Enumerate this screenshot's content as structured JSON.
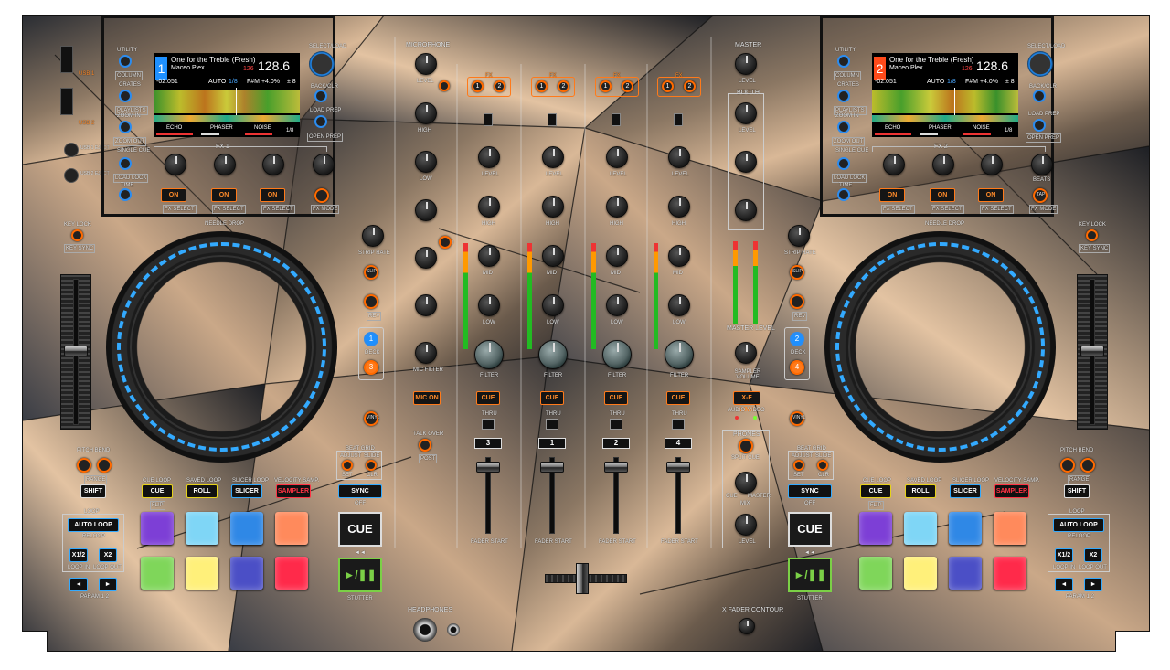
{
  "app": {
    "title": "DJ Controller Skin"
  },
  "colors": {
    "accent_orange": "#ff7a1a",
    "accent_blue": "#33aaff",
    "cue_yellow": "#e6d21a",
    "sampler_red": "#ff3344",
    "body_dark": "#2a2a2a"
  },
  "ports": {
    "usb1": "USB 1",
    "usb2": "USB 2",
    "usb1_eject": "USB 1 EJECT",
    "usb2_eject": "USB 2 EJECT"
  },
  "left": {
    "screen": {
      "deck_num": "1",
      "title": "One for the Treble (Fresh)",
      "artist": "Maceo Plex",
      "bpm": "128.6",
      "bpm_small": "126",
      "time": "-02:051",
      "auto": "AUTO",
      "loop": "1/8",
      "key": "F#M +4.0%",
      "range": "± 8",
      "fx": [
        "ECHO",
        "PHASER",
        "NOISE"
      ],
      "beats": "1/8"
    },
    "side_left": [
      "UTILITY",
      "VIEW",
      "COLUMN",
      "CRATES",
      "PLAYLISTS",
      "ZOOM IN",
      "ZOOM OUT",
      "SINGLE CUE",
      "LOAD LOCK",
      "TIME"
    ],
    "side_right": [
      "SELECT/LOAD",
      "BACK/CLR",
      "LOAD PREP",
      "OPEN PREP"
    ],
    "fx_title": "FX 1",
    "fx_knob_labels": [
      "MIN",
      "MAX"
    ],
    "fx_on": "ON",
    "fx_select": "FX SELECT",
    "beats": "BEATS",
    "tap": "TAP",
    "fx_mode": "FX MODE",
    "key_lock": "KEY LOCK",
    "key_sync": "KEY SYNC",
    "needle_drop": "NEEDLE DROP",
    "strip_rate": "STRIP RATE",
    "slip": "SLIP",
    "censor": "CENSOR",
    "rev": "REV",
    "deck": "DECK",
    "deck_a": "1",
    "deck_b": "3",
    "vinyl": "VINYL",
    "pitch_bend": "PITCH BEND",
    "range": "RANGE",
    "shift": "SHIFT",
    "beat_grid": "BEAT GRID",
    "adjust": "ADJUST",
    "slide": "SLIDE",
    "set": "SET",
    "clr": "CLR",
    "sync": "SYNC",
    "off": "OFF",
    "modes": {
      "cue_loop": "CUE LOOP",
      "saved_loop": "SAVED LOOP",
      "slicer_loop": "SLICER LOOP",
      "velocity": "VELOCITY SAMP.",
      "cue": "CUE",
      "roll": "ROLL",
      "slicer": "SLICER",
      "sampler": "SAMPLER",
      "flip": "FLIP"
    },
    "loop": {
      "title": "LOOP",
      "auto": "AUTO LOOP",
      "reloop": "RELOOP",
      "half": "X1/2",
      "double": "X2",
      "in": "LOOP IN",
      "out": "LOOP OUT",
      "param": "PARAM 1 2"
    },
    "transport": {
      "cue": "CUE",
      "play": "►/❚❚",
      "stutter": "STUTTER"
    }
  },
  "right": {
    "screen": {
      "deck_num": "2",
      "title": "One for the Treble (Fresh)",
      "artist": "Maceo Plex",
      "bpm": "128.6",
      "bpm_small": "126",
      "time": "-02:051",
      "auto": "AUTO",
      "loop": "1/8",
      "key": "F#M +4.0%",
      "range": "± 8",
      "fx": [
        "ECHO",
        "PHASER",
        "NOISE"
      ],
      "beats": "1/8"
    },
    "side_left": [
      "UTILITY",
      "VIEW",
      "COLUMN",
      "CRATES",
      "PLAYLISTS",
      "ZOOM IN",
      "ZOOM OUT",
      "SINGLE CUE",
      "LOAD LOCK",
      "TIME"
    ],
    "side_right": [
      "SELECT/LOAD",
      "BACK/CLR",
      "LOAD PREP",
      "OPEN PREP"
    ],
    "fx_title": "FX 2",
    "fx_on": "ON",
    "fx_select": "FX SELECT",
    "beats": "BEATS",
    "tap": "TAP",
    "fx_mode": "FX MODE",
    "key_lock": "KEY LOCK",
    "key_sync": "KEY SYNC",
    "needle_drop": "NEEDLE DROP",
    "strip_rate": "STRIP RATE",
    "slip": "SLIP",
    "censor": "CENSOR",
    "rev": "REV",
    "deck": "DECK",
    "deck_a": "2",
    "deck_b": "4",
    "vinyl": "VINYL",
    "pitch_bend": "PITCH BEND",
    "range": "RANGE",
    "shift": "SHIFT",
    "beat_grid": "BEAT GRID",
    "adjust": "ADJUST",
    "slide": "SLIDE",
    "set": "SET",
    "clr": "CLR",
    "sync": "SYNC",
    "off": "OFF",
    "modes": {
      "cue_loop": "CUE LOOP",
      "saved_loop": "SAVED LOOP",
      "slicer_loop": "SLICER LOOP",
      "velocity": "VELOCITY SAMP.",
      "cue": "CUE",
      "roll": "ROLL",
      "slicer": "SLICER",
      "sampler": "SAMPLER",
      "flip": "FLIP"
    },
    "loop": {
      "title": "LOOP",
      "auto": "AUTO LOOP",
      "reloop": "RELOOP",
      "half": "X1/2",
      "double": "X2",
      "in": "LOOP IN",
      "out": "LOOP OUT",
      "param": "PARAM 1 2"
    },
    "transport": {
      "cue": "CUE",
      "play": "►/❚❚",
      "stutter": "STUTTER"
    }
  },
  "mixer": {
    "microphone": "MICROPHONE",
    "mic_level": "LEVEL",
    "mic_high": "HIGH",
    "mic_low": "LOW",
    "mic_echo": "ECHO",
    "mic_on": "MIC ON",
    "talk_over": "TALK OVER",
    "post": "POST",
    "mic_level2": "MIC 2 LEVEL",
    "mic_filter": "MIC FILTER",
    "channels": [
      {
        "num": "3",
        "fx": [
          "1",
          "2"
        ],
        "pfl": "PFL",
        "cue": "CUE"
      },
      {
        "num": "1",
        "fx": [
          "1",
          "2"
        ],
        "pfl": "PFL",
        "cue": "CUE"
      },
      {
        "num": "2",
        "fx": [
          "1",
          "2"
        ],
        "pfl": "PFL",
        "cue": "CUE"
      },
      {
        "num": "4",
        "fx": [
          "1",
          "2"
        ],
        "pfl": "PFL",
        "cue": "CUE"
      }
    ],
    "fx_label": "FX",
    "level": "LEVEL",
    "high": "HIGH",
    "mid": "MID",
    "low": "LOW",
    "filter": "FILTER",
    "min": "MIN",
    "max": "MAX",
    "fader_start": "FADER START",
    "thru": "THRU",
    "master": "MASTER",
    "master_level": "MASTER LEVEL",
    "booth": "BOOTH",
    "sampler_volume": "SAMPLER VOLUME",
    "x_link": "X-F LINK",
    "audio": "AUDIO",
    "video": "VIDEO",
    "phones": "PHONES",
    "split_cue": "SPLIT CUE",
    "phones_mix": "MIX",
    "phones_level": "LEVEL",
    "cue_label": "CUE",
    "master_label": "MASTER",
    "headphones": "HEADPHONES",
    "x_fader_contour": "X FADER CONTOUR",
    "vu_scale": [
      "CLIP",
      "+6",
      "+3",
      "0",
      "-3",
      "-6",
      "-10"
    ]
  }
}
